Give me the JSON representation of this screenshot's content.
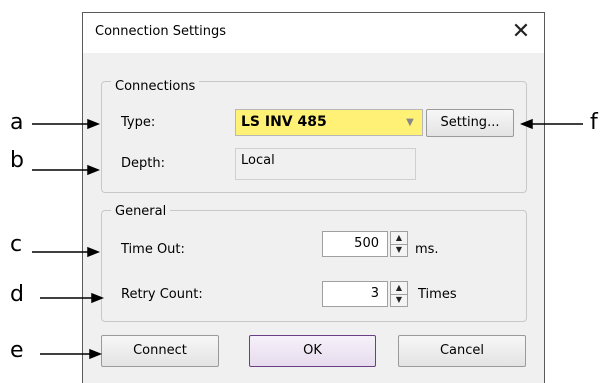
{
  "dialog": {
    "title": "Connection Settings",
    "close_glyph": "✕"
  },
  "connections": {
    "legend": "Connections",
    "type_label": "Type:",
    "type_value": "LS INV 485",
    "setting_button": "Setting...",
    "depth_label": "Depth:",
    "depth_value": "Local"
  },
  "general": {
    "legend": "General",
    "timeout_label": "Time Out:",
    "timeout_value": "500",
    "timeout_unit": "ms.",
    "retry_label": "Retry Count:",
    "retry_value": "3",
    "retry_unit": "Times"
  },
  "footer": {
    "connect": "Connect",
    "ok": "OK",
    "cancel": "Cancel"
  },
  "annotations": [
    "a",
    "b",
    "c",
    "d",
    "e",
    "f"
  ],
  "icons": {
    "close": "close-icon",
    "dropdown": "chevron-down-icon",
    "spin_up": "spin-up-icon",
    "spin_down": "spin-down-icon"
  },
  "colors": {
    "combo_highlight": "#fff176",
    "ok_border": "#6a3f86"
  }
}
